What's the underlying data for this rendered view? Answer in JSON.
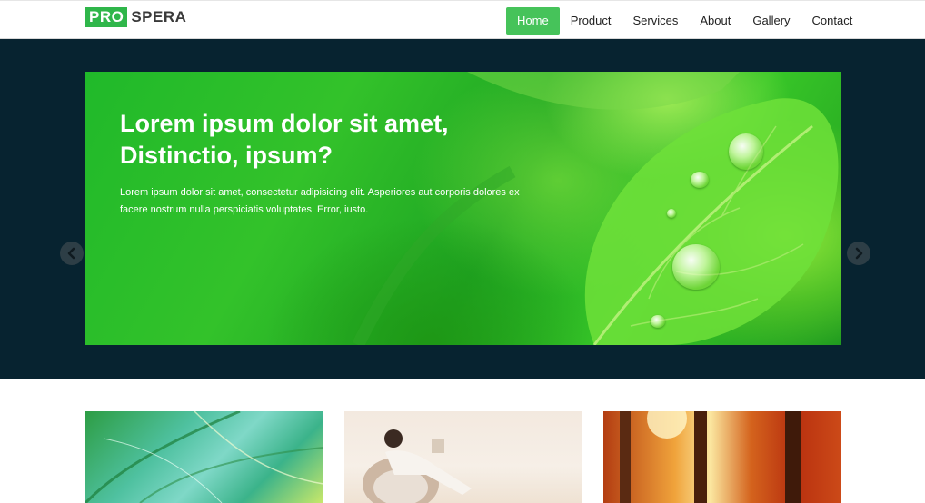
{
  "brand": {
    "part1": "PRO",
    "part2": "SPERA",
    "accent_color": "#2fb64a"
  },
  "nav": {
    "active_color": "#46c35a",
    "items": [
      {
        "label": "Home",
        "active": true
      },
      {
        "label": "Product",
        "active": false
      },
      {
        "label": "Services",
        "active": false
      },
      {
        "label": "About",
        "active": false
      },
      {
        "label": "Gallery",
        "active": false
      },
      {
        "label": "Contact",
        "active": false
      }
    ]
  },
  "hero": {
    "background_color": "#072330",
    "title_line1": "Lorem ipsum dolor sit amet,",
    "title_line2": "Distinctio, ipsum?",
    "text": "Lorem ipsum dolor sit amet, consectetur adipisicing elit. Asperiores aut corporis dolores ex facere nostrum nulla perspiciatis voluptates. Error, iusto.",
    "prev_icon": "chevron-left-icon",
    "next_icon": "chevron-right-icon"
  },
  "cards": [
    {
      "image": "leaf-skeleton-image"
    },
    {
      "image": "woman-reading-image"
    },
    {
      "image": "autumn-forest-image"
    }
  ]
}
